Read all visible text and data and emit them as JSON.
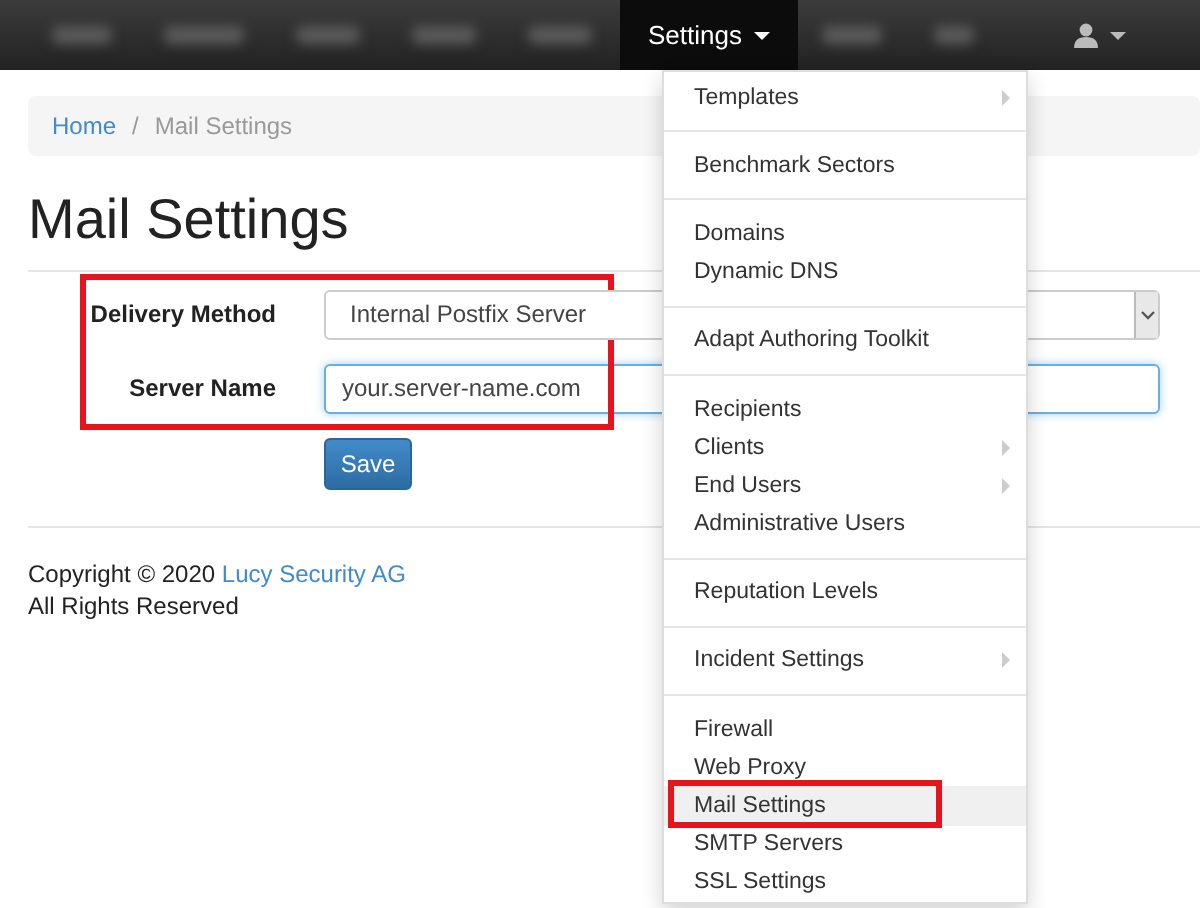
{
  "navbar": {
    "active_menu": {
      "label": "Settings",
      "open": true
    }
  },
  "breadcrumb": [
    {
      "label": "Home",
      "kind": "link"
    },
    {
      "label": "/",
      "kind": "separator"
    },
    {
      "label": "Mail Settings",
      "kind": "current"
    }
  ],
  "page_title": "Mail Settings",
  "form": {
    "highlighted": true,
    "fields": [
      {
        "label": "Delivery Method",
        "kind": "select",
        "value": "Internal Postfix Server"
      },
      {
        "label": "Server Name",
        "kind": "text",
        "value": "your.server-name.com",
        "focused": true
      }
    ],
    "submit": "Save"
  },
  "footer": {
    "copyright": "Copyright © 2020",
    "company": "Lucy Security AG",
    "rights": "All Rights Reserved"
  },
  "settings_menu": [
    [
      {
        "label": "Templates",
        "submenu": true,
        "selected": false,
        "highlighted": false
      }
    ],
    [
      {
        "label": "Benchmark Sectors",
        "submenu": false,
        "selected": false,
        "highlighted": false
      }
    ],
    [
      {
        "label": "Domains",
        "submenu": false,
        "selected": false,
        "highlighted": false
      },
      {
        "label": "Dynamic DNS",
        "submenu": false,
        "selected": false,
        "highlighted": false
      }
    ],
    [
      {
        "label": "Adapt Authoring Toolkit",
        "submenu": false,
        "selected": false,
        "highlighted": false
      }
    ],
    [
      {
        "label": "Recipients",
        "submenu": false,
        "selected": false,
        "highlighted": false
      },
      {
        "label": "Clients",
        "submenu": true,
        "selected": false,
        "highlighted": false
      },
      {
        "label": "End Users",
        "submenu": true,
        "selected": false,
        "highlighted": false
      },
      {
        "label": "Administrative Users",
        "submenu": false,
        "selected": false,
        "highlighted": false
      }
    ],
    [
      {
        "label": "Reputation Levels",
        "submenu": false,
        "selected": false,
        "highlighted": false
      }
    ],
    [
      {
        "label": "Incident Settings",
        "submenu": true,
        "selected": false,
        "highlighted": false
      }
    ],
    [
      {
        "label": "Firewall",
        "submenu": false,
        "selected": false,
        "highlighted": false
      },
      {
        "label": "Web Proxy",
        "submenu": false,
        "selected": false,
        "highlighted": false
      },
      {
        "label": "Mail Settings",
        "submenu": false,
        "selected": true,
        "highlighted": true
      },
      {
        "label": "SMTP Servers",
        "submenu": false,
        "selected": false,
        "highlighted": false
      },
      {
        "label": "SSL Settings",
        "submenu": false,
        "selected": false,
        "highlighted": false
      }
    ]
  ]
}
